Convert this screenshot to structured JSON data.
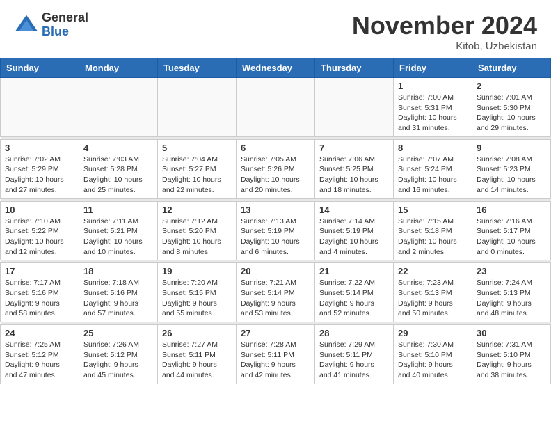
{
  "header": {
    "logo_line1": "General",
    "logo_line2": "Blue",
    "month_title": "November 2024",
    "location": "Kitob, Uzbekistan"
  },
  "days_of_week": [
    "Sunday",
    "Monday",
    "Tuesday",
    "Wednesday",
    "Thursday",
    "Friday",
    "Saturday"
  ],
  "weeks": [
    [
      {
        "day": "",
        "info": ""
      },
      {
        "day": "",
        "info": ""
      },
      {
        "day": "",
        "info": ""
      },
      {
        "day": "",
        "info": ""
      },
      {
        "day": "",
        "info": ""
      },
      {
        "day": "1",
        "info": "Sunrise: 7:00 AM\nSunset: 5:31 PM\nDaylight: 10 hours\nand 31 minutes."
      },
      {
        "day": "2",
        "info": "Sunrise: 7:01 AM\nSunset: 5:30 PM\nDaylight: 10 hours\nand 29 minutes."
      }
    ],
    [
      {
        "day": "3",
        "info": "Sunrise: 7:02 AM\nSunset: 5:29 PM\nDaylight: 10 hours\nand 27 minutes."
      },
      {
        "day": "4",
        "info": "Sunrise: 7:03 AM\nSunset: 5:28 PM\nDaylight: 10 hours\nand 25 minutes."
      },
      {
        "day": "5",
        "info": "Sunrise: 7:04 AM\nSunset: 5:27 PM\nDaylight: 10 hours\nand 22 minutes."
      },
      {
        "day": "6",
        "info": "Sunrise: 7:05 AM\nSunset: 5:26 PM\nDaylight: 10 hours\nand 20 minutes."
      },
      {
        "day": "7",
        "info": "Sunrise: 7:06 AM\nSunset: 5:25 PM\nDaylight: 10 hours\nand 18 minutes."
      },
      {
        "day": "8",
        "info": "Sunrise: 7:07 AM\nSunset: 5:24 PM\nDaylight: 10 hours\nand 16 minutes."
      },
      {
        "day": "9",
        "info": "Sunrise: 7:08 AM\nSunset: 5:23 PM\nDaylight: 10 hours\nand 14 minutes."
      }
    ],
    [
      {
        "day": "10",
        "info": "Sunrise: 7:10 AM\nSunset: 5:22 PM\nDaylight: 10 hours\nand 12 minutes."
      },
      {
        "day": "11",
        "info": "Sunrise: 7:11 AM\nSunset: 5:21 PM\nDaylight: 10 hours\nand 10 minutes."
      },
      {
        "day": "12",
        "info": "Sunrise: 7:12 AM\nSunset: 5:20 PM\nDaylight: 10 hours\nand 8 minutes."
      },
      {
        "day": "13",
        "info": "Sunrise: 7:13 AM\nSunset: 5:19 PM\nDaylight: 10 hours\nand 6 minutes."
      },
      {
        "day": "14",
        "info": "Sunrise: 7:14 AM\nSunset: 5:19 PM\nDaylight: 10 hours\nand 4 minutes."
      },
      {
        "day": "15",
        "info": "Sunrise: 7:15 AM\nSunset: 5:18 PM\nDaylight: 10 hours\nand 2 minutes."
      },
      {
        "day": "16",
        "info": "Sunrise: 7:16 AM\nSunset: 5:17 PM\nDaylight: 10 hours\nand 0 minutes."
      }
    ],
    [
      {
        "day": "17",
        "info": "Sunrise: 7:17 AM\nSunset: 5:16 PM\nDaylight: 9 hours\nand 58 minutes."
      },
      {
        "day": "18",
        "info": "Sunrise: 7:18 AM\nSunset: 5:16 PM\nDaylight: 9 hours\nand 57 minutes."
      },
      {
        "day": "19",
        "info": "Sunrise: 7:20 AM\nSunset: 5:15 PM\nDaylight: 9 hours\nand 55 minutes."
      },
      {
        "day": "20",
        "info": "Sunrise: 7:21 AM\nSunset: 5:14 PM\nDaylight: 9 hours\nand 53 minutes."
      },
      {
        "day": "21",
        "info": "Sunrise: 7:22 AM\nSunset: 5:14 PM\nDaylight: 9 hours\nand 52 minutes."
      },
      {
        "day": "22",
        "info": "Sunrise: 7:23 AM\nSunset: 5:13 PM\nDaylight: 9 hours\nand 50 minutes."
      },
      {
        "day": "23",
        "info": "Sunrise: 7:24 AM\nSunset: 5:13 PM\nDaylight: 9 hours\nand 48 minutes."
      }
    ],
    [
      {
        "day": "24",
        "info": "Sunrise: 7:25 AM\nSunset: 5:12 PM\nDaylight: 9 hours\nand 47 minutes."
      },
      {
        "day": "25",
        "info": "Sunrise: 7:26 AM\nSunset: 5:12 PM\nDaylight: 9 hours\nand 45 minutes."
      },
      {
        "day": "26",
        "info": "Sunrise: 7:27 AM\nSunset: 5:11 PM\nDaylight: 9 hours\nand 44 minutes."
      },
      {
        "day": "27",
        "info": "Sunrise: 7:28 AM\nSunset: 5:11 PM\nDaylight: 9 hours\nand 42 minutes."
      },
      {
        "day": "28",
        "info": "Sunrise: 7:29 AM\nSunset: 5:11 PM\nDaylight: 9 hours\nand 41 minutes."
      },
      {
        "day": "29",
        "info": "Sunrise: 7:30 AM\nSunset: 5:10 PM\nDaylight: 9 hours\nand 40 minutes."
      },
      {
        "day": "30",
        "info": "Sunrise: 7:31 AM\nSunset: 5:10 PM\nDaylight: 9 hours\nand 38 minutes."
      }
    ]
  ]
}
